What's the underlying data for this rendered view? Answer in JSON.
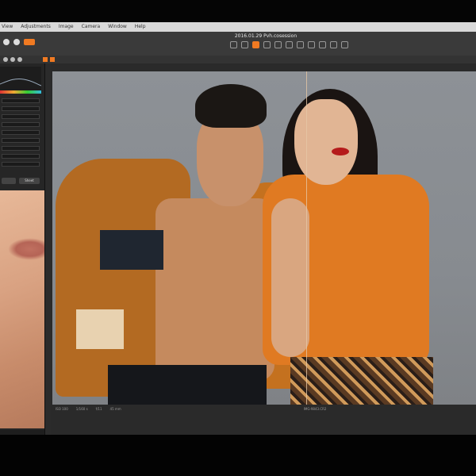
{
  "menu": {
    "items": [
      "View",
      "Adjustments",
      "Image",
      "Camera",
      "Window",
      "Help"
    ]
  },
  "window": {
    "title": "2016.01.29 Pvh.cosession"
  },
  "tools": [
    "pan-tool-icon",
    "zoom-tool-icon",
    "crop-tool-icon",
    "straighten-tool-icon",
    "picker-tool-icon",
    "keystone-tool-icon",
    "spot-tool-icon",
    "mask-tool-icon",
    "brush-tool-icon",
    "erase-tool-icon",
    "adjust-tool-icon"
  ],
  "left_panel": {
    "btn_right": "Sheet"
  },
  "viewer": {
    "footer_iso": "ISO 100",
    "footer_shutter": "1/160 s",
    "footer_aperture": "f/11",
    "footer_focal": "45 mm",
    "footer_file": "IMG-9843.CR2"
  },
  "colors": {
    "accent": "#f07a22",
    "panel": "#262626",
    "canvas": "#8d9196"
  }
}
